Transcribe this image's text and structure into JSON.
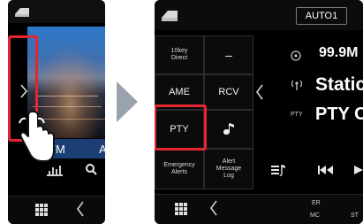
{
  "left_screen": {
    "band_label": "FM",
    "band_label_partial": "A",
    "bottom_icons": [
      "grid-icon",
      "chevron-left-icon"
    ]
  },
  "right_screen": {
    "preset_label": "AUTO1",
    "frequency": "99.9M",
    "station_text": "Static",
    "pty_prefix": "PTY",
    "pty_text": "PTY C",
    "menu": {
      "tenkey": "10key\nDirect",
      "dash": "–",
      "ame": "AME",
      "rcv": "RCV",
      "pty": "PTY",
      "emergency": "Emergency\nAlerts",
      "alert_log": "Alert\nMessage\nLog"
    },
    "bottom_labels": {
      "er": "ER",
      "mc": "MC",
      "st": "ST"
    }
  },
  "colors": {
    "highlight": "#e3262f",
    "arrow": "#9aa3ab",
    "band_bar": "#1b3f74"
  }
}
